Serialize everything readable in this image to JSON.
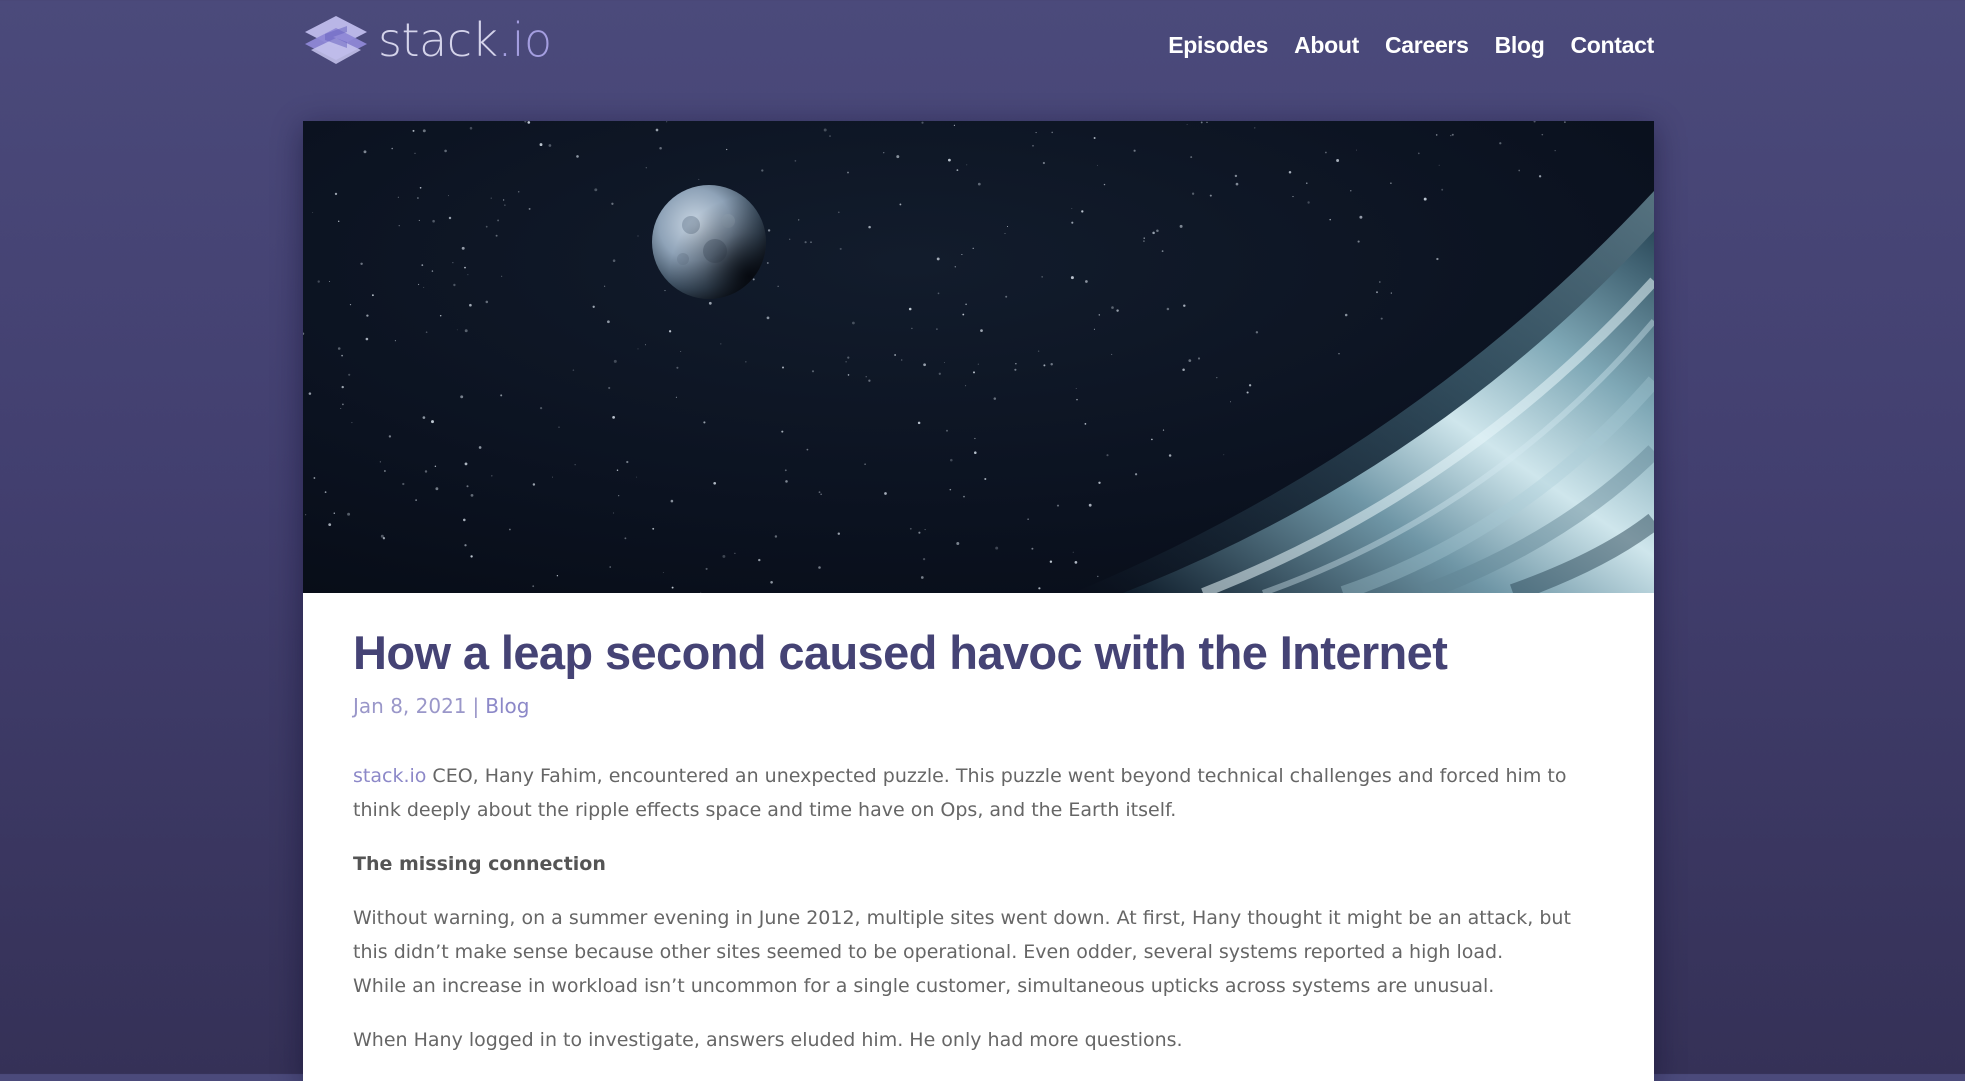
{
  "brand": {
    "name": "stack",
    "name_suffix": ".io",
    "logo_icon": "stacked-layers-logo-icon"
  },
  "nav": {
    "items": [
      {
        "label": "Episodes"
      },
      {
        "label": "About"
      },
      {
        "label": "Careers"
      },
      {
        "label": "Blog"
      },
      {
        "label": "Contact"
      }
    ]
  },
  "hero": {
    "description": "starfield-with-moon-and-earth-horizon"
  },
  "post": {
    "title": "How a leap second caused havoc with the Internet",
    "date": "Jan 8, 2021",
    "separator": "|",
    "category": "Blog"
  },
  "content": {
    "p1_link": "stack.io",
    "p1_text": " CEO, Hany Fahim, encountered an unexpected puzzle. This puzzle went beyond technical challenges and forced him to think deeply about the ripple effects space and time have on Ops, and the Earth itself.",
    "heading": "The missing connection",
    "p2_line1": "Without warning, on a summer evening in June 2012, multiple sites went down. At first, Hany thought it might be an attack, but this didn’t make sense because other sites seemed to be operational. Even odder, several systems reported a high load.",
    "p2_line2": "While an increase in workload isn’t uncommon for a single customer, simultaneous upticks across systems are unusual.",
    "p3": "When Hany logged in to investigate, answers eluded him. He only had more questions."
  },
  "colors": {
    "page_bg_top": "#4b4a7b",
    "page_bg_bottom": "#353157",
    "title": "#454375",
    "accent": "#8c88c8",
    "body_text": "#666666"
  }
}
